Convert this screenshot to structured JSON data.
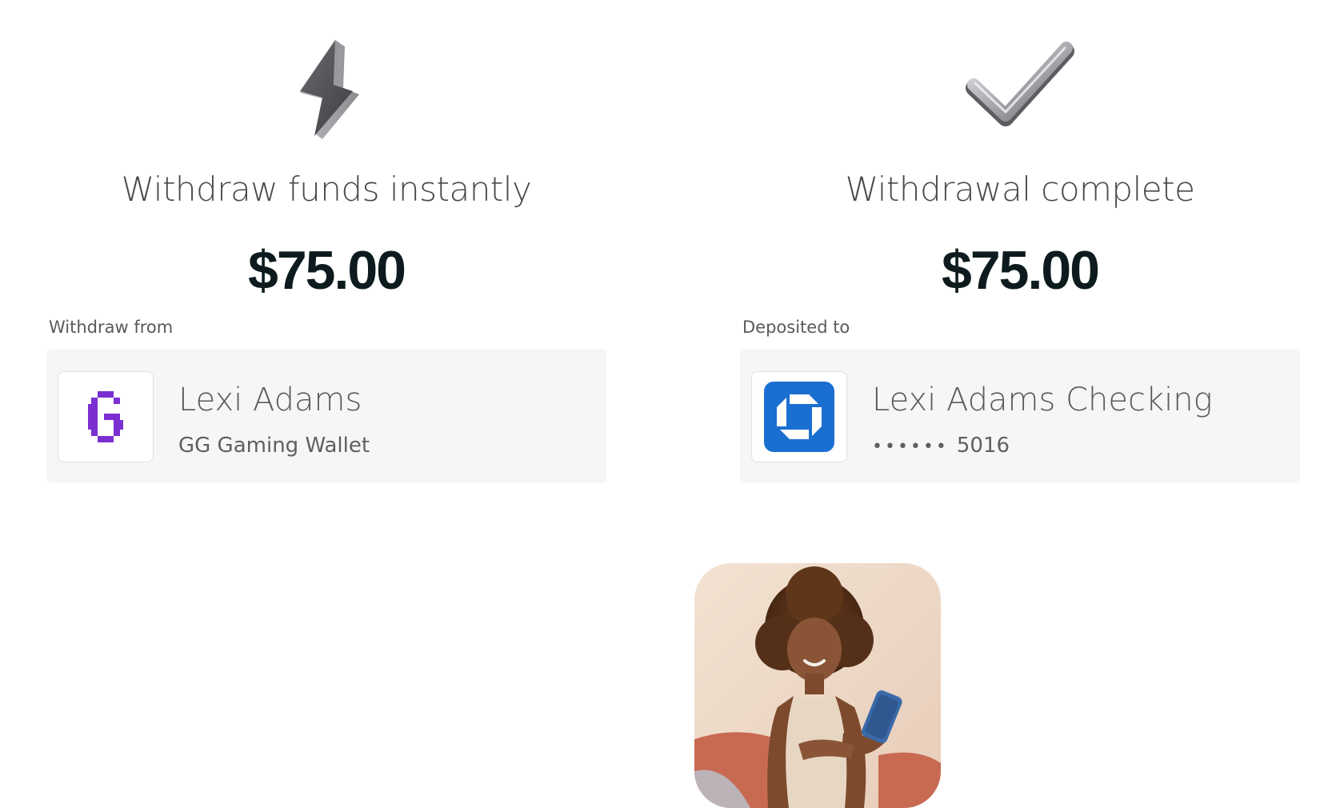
{
  "withdraw": {
    "icon": "lightning-bolt-icon",
    "title": "Withdraw funds instantly",
    "amount": "$75.00",
    "section_label": "Withdraw from",
    "account": {
      "logo": "gg-gaming-logo",
      "logo_letter": "G",
      "name": "Lexi Adams",
      "subtitle": "GG Gaming Wallet"
    }
  },
  "complete": {
    "icon": "checkmark-icon",
    "title": "Withdrawal complete",
    "amount": "$75.00",
    "section_label": "Deposited to",
    "account": {
      "logo": "bank-logo",
      "name": "Lexi Adams Checking",
      "masked": "••••••",
      "last4": "5016"
    }
  },
  "photo": {
    "subject": "woman-using-phone"
  },
  "colors": {
    "gaming_purple": "#7b2fd0",
    "bank_blue": "#1a6fd1",
    "amount_text": "#0d1b1e",
    "card_bg": "#f6f6f6"
  }
}
